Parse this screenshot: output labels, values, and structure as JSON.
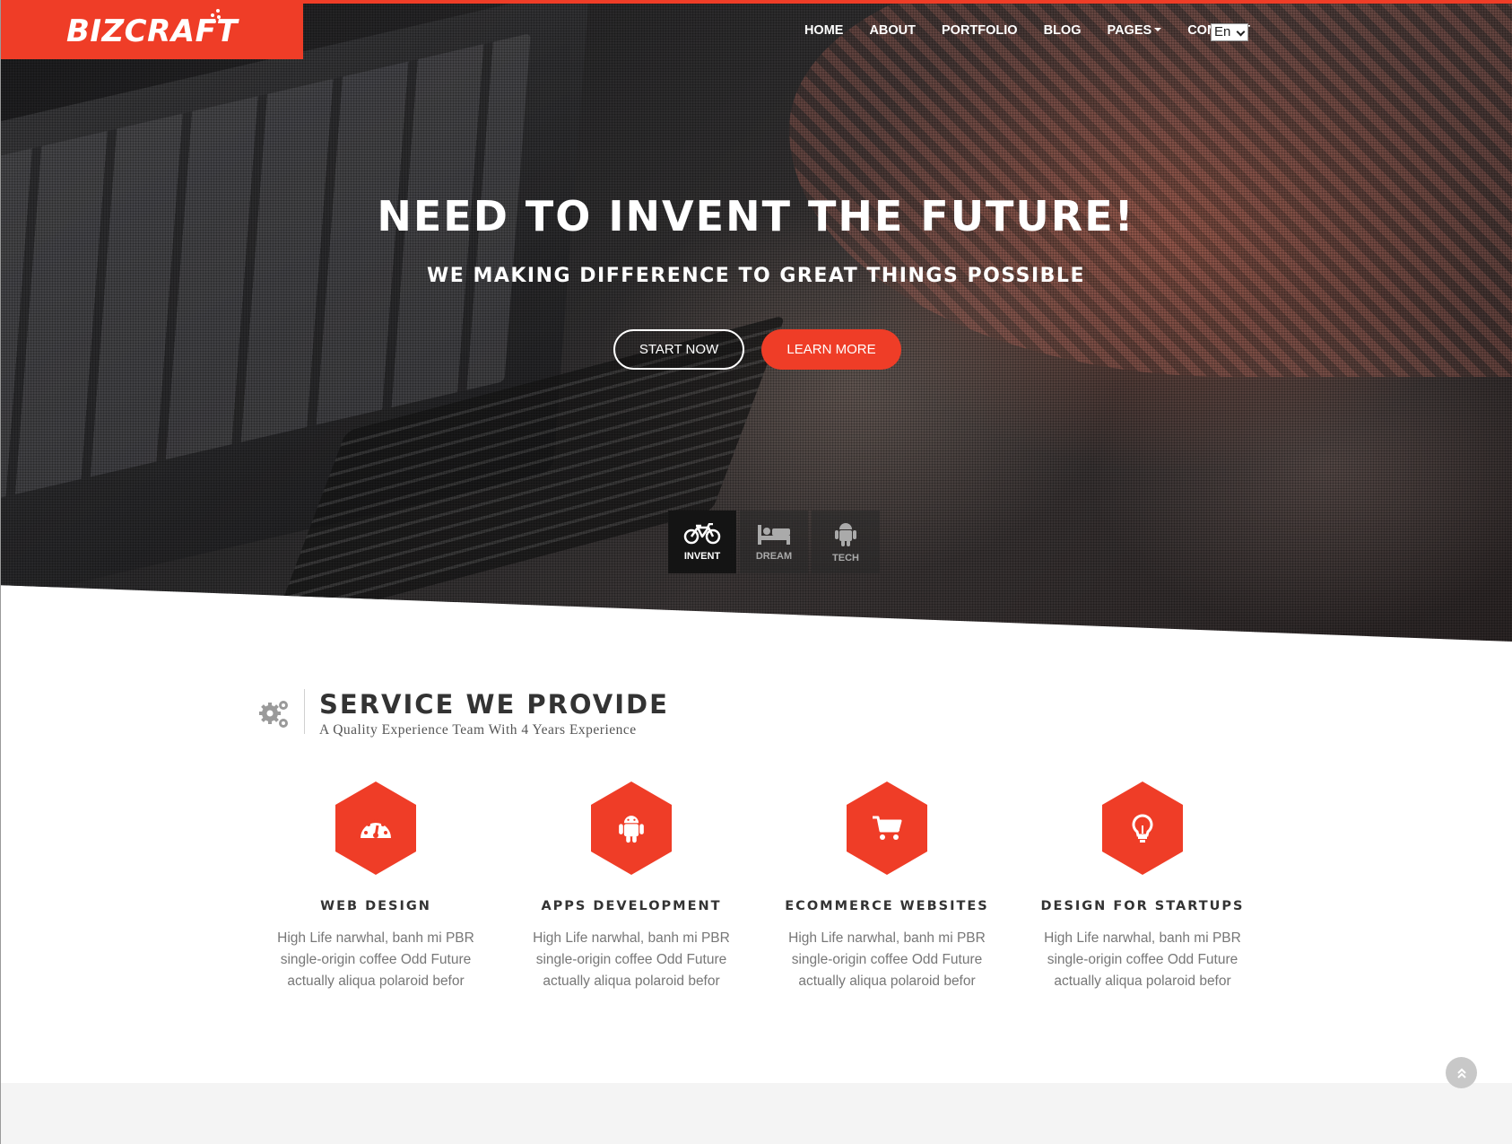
{
  "brand": {
    "name": "BizCraft"
  },
  "nav": {
    "items": [
      {
        "label": "HOME"
      },
      {
        "label": "ABOUT"
      },
      {
        "label": "PORTFOLIO"
      },
      {
        "label": "BLOG"
      },
      {
        "label": "PAGES",
        "dropdown": true
      },
      {
        "label": "CONTACT"
      }
    ],
    "language": "En"
  },
  "hero": {
    "title": "NEED TO INVENT THE FUTURE!",
    "subtitle": "WE MAKING DIFFERENCE TO GREAT THINGS POSSIBLE",
    "start_button": "START NOW",
    "learn_button": "LEARN MORE",
    "tabs": [
      {
        "label": "INVENT",
        "icon": "bicycle-icon",
        "active": true
      },
      {
        "label": "DREAM",
        "icon": "bed-icon",
        "active": false
      },
      {
        "label": "TECH",
        "icon": "android-icon",
        "active": false
      }
    ]
  },
  "services": {
    "title": "SERVICE WE PROVIDE",
    "subtitle": "A Quality Experience Team With 4 Years Experience",
    "icon": "gears-icon",
    "items": [
      {
        "title": "WEB DESIGN",
        "icon": "dashboard-icon",
        "text": "High Life narwhal, banh mi PBR single-origin coffee Odd Future actually aliqua polaroid befor"
      },
      {
        "title": "APPS DEVELOPMENT",
        "icon": "android-icon",
        "text": "High Life narwhal, banh mi PBR single-origin coffee Odd Future actually aliqua polaroid befor"
      },
      {
        "title": "ECOMMERCE WEBSITES",
        "icon": "cart-icon",
        "text": "High Life narwhal, banh mi PBR single-origin coffee Odd Future actually aliqua polaroid befor"
      },
      {
        "title": "DESIGN FOR STARTUPS",
        "icon": "lightbulb-icon",
        "text": "High Life narwhal, banh mi PBR single-origin coffee Odd Future actually aliqua polaroid befor"
      }
    ]
  },
  "colors": {
    "accent": "#ef3d27",
    "text": "#333333",
    "muted": "#777777"
  },
  "scroll_top_icon": "double-chevron-up-icon"
}
